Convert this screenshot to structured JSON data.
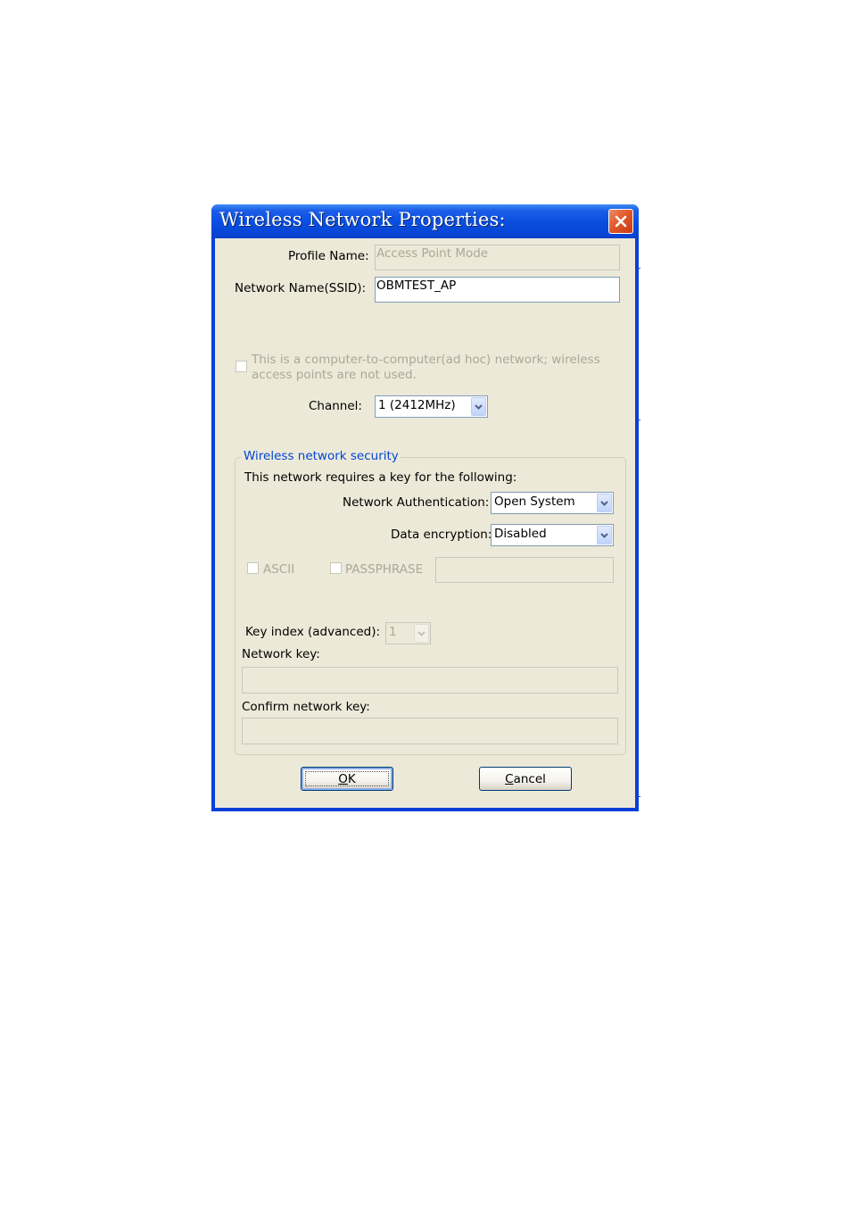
{
  "dialog": {
    "title": "Wireless Network Properties:",
    "close_icon": "close-icon"
  },
  "profile": {
    "label": "Profile Name:",
    "value": "Access Point Mode"
  },
  "ssid": {
    "label": "Network Name(SSID):",
    "value": "OBMTEST_AP"
  },
  "adhoc": {
    "text_line1": "This is a computer-to-computer(ad hoc) network; wireless",
    "text_line2": "access points are not used.",
    "checked": false
  },
  "channel": {
    "label": "Channel:",
    "selected": "1  (2412MHz)"
  },
  "security": {
    "legend": "Wireless network security",
    "intro": "This network requires a key for the following:",
    "auth_label": "Network Authentication:",
    "auth_selected": "Open System",
    "enc_label": "Data encryption:",
    "enc_selected": "Disabled",
    "ascii_label": "ASCII",
    "passphrase_label": "PASSPHRASE",
    "passphrase_value": "",
    "key_index_label": "Key index (advanced):",
    "key_index_selected": "1",
    "network_key_label": "Network key:",
    "network_key_value": "",
    "confirm_key_label": "Confirm network key:",
    "confirm_key_value": ""
  },
  "buttons": {
    "ok_mnemonic": "O",
    "ok_rest": "K",
    "cancel_mnemonic": "C",
    "cancel_rest": "ancel"
  },
  "colors": {
    "titlebar": "#0a4fe0",
    "face": "#ece9d8",
    "legend_text": "#0046d5",
    "disabled_text": "#aca899",
    "close_button": "#e05a2c"
  }
}
